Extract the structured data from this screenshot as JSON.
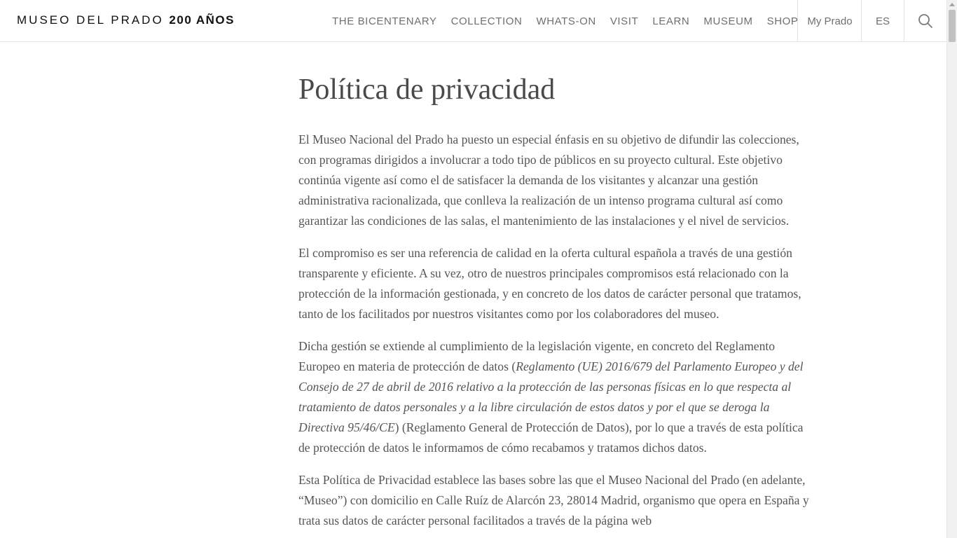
{
  "header": {
    "logo_main": "MUSEO DEL PRADO",
    "logo_strong": "200 AÑOS",
    "nav": [
      {
        "label": "THE BICENTENARY"
      },
      {
        "label": "COLLECTION"
      },
      {
        "label": "WHATS-ON"
      },
      {
        "label": "VISIT"
      },
      {
        "label": "LEARN"
      },
      {
        "label": "MUSEUM"
      },
      {
        "label": "SHOP"
      }
    ],
    "my_prado": "My Prado",
    "language": "ES",
    "search_icon": "search-icon"
  },
  "page": {
    "title": "Política de privacidad",
    "paragraphs": {
      "p1": "El Museo Nacional del Prado ha puesto un especial énfasis en su objetivo de difundir las colecciones, con programas dirigidos a involucrar a todo tipo de públicos en su proyecto cultural. Este objetivo continúa vigente así como el de satisfacer la demanda de los visitantes y alcanzar una gestión administrativa racionalizada, que conlleva la realización de un intenso programa cultural así como garantizar las condiciones de las salas, el mantenimiento de las instalaciones y el nivel de servicios.",
      "p2": "El compromiso es ser una referencia de calidad en la oferta cultural española a través de una gestión transparente y eficiente. A su vez, otro de nuestros principales compromisos está relacionado con la protección de la información gestionada, y en concreto de los datos de carácter personal que tratamos, tanto de los facilitados por nuestros visitantes como por los colaboradores del museo.",
      "p3_start": "Dicha gestión se extiende al cumplimiento de la legislación vigente, en concreto del Reglamento Europeo en materia de protección de datos (",
      "p3_italic": "Reglamento (UE) 2016/679 del Parlamento Europeo y del Consejo de 27 de abril de 2016 relativo a la protección de las personas físicas en lo que respecta al tratamiento de datos personales y a la libre circulación de estos datos y por el que se deroga la Directiva 95/46/CE",
      "p3_end": ") (Reglamento General de Protección de Datos), por lo que a través de esta política de protección de datos le informamos de cómo recabamos y tratamos dichos datos.",
      "p4": "Esta Política de Privacidad establece las bases sobre las que el Museo Nacional del Prado (en adelante, “Museo”) con domicilio en Calle Ruíz de Alarcón 23, 28014 Madrid, organismo que opera en España y trata sus datos de carácter personal facilitados a través de la página web"
    }
  }
}
